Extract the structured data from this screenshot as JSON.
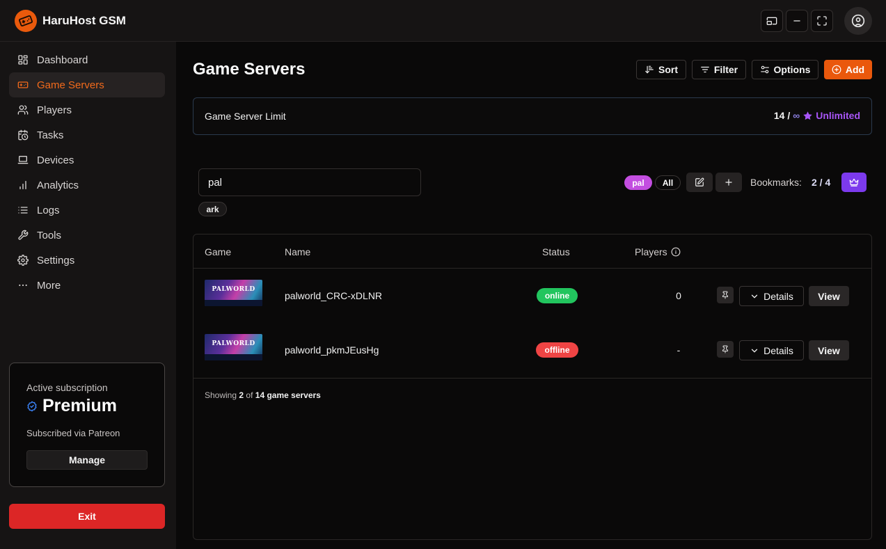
{
  "app": {
    "title": "HaruHost GSM"
  },
  "sidebar": {
    "items": [
      {
        "label": "Dashboard",
        "icon": "dashboard-icon"
      },
      {
        "label": "Game Servers",
        "icon": "gamepad-icon",
        "active": true
      },
      {
        "label": "Players",
        "icon": "users-icon"
      },
      {
        "label": "Tasks",
        "icon": "calendar-clock-icon"
      },
      {
        "label": "Devices",
        "icon": "laptop-icon"
      },
      {
        "label": "Analytics",
        "icon": "bar-chart-icon"
      },
      {
        "label": "Logs",
        "icon": "list-icon"
      },
      {
        "label": "Tools",
        "icon": "wrench-icon"
      },
      {
        "label": "Settings",
        "icon": "gear-icon"
      },
      {
        "label": "More",
        "icon": "ellipsis-icon"
      }
    ],
    "subscription": {
      "label": "Active subscription",
      "plan": "Premium",
      "via": "Subscribed via Patreon",
      "manage_label": "Manage"
    },
    "exit_label": "Exit"
  },
  "main": {
    "title": "Game Servers",
    "toolbar": {
      "sort_label": "Sort",
      "filter_label": "Filter",
      "options_label": "Options",
      "add_label": "Add"
    },
    "limit": {
      "label": "Game Server Limit",
      "used": "14 /",
      "max": "∞",
      "tier": "Unlimited"
    },
    "search": {
      "value": "pal",
      "placeholder": ""
    },
    "tags": {
      "ark": "ark",
      "pal": "pal",
      "all": "All"
    },
    "bookmarks": {
      "label": "Bookmarks:",
      "count": "2 / 4"
    },
    "table": {
      "headers": {
        "game": "Game",
        "name": "Name",
        "status": "Status",
        "players": "Players"
      },
      "rows": [
        {
          "game_logo": "PALWORLD",
          "name": "palworld_CRC-xDLNR",
          "status": "online",
          "players": "0",
          "details_label": "Details",
          "view_label": "View"
        },
        {
          "game_logo": "PALWORLD",
          "name": "palworld_pkmJEusHg",
          "status": "offline",
          "players": "-",
          "details_label": "Details",
          "view_label": "View"
        }
      ],
      "footer": {
        "prefix": "Showing",
        "shown": "2",
        "of": "of",
        "total": "14",
        "suffix": "game servers"
      }
    }
  },
  "colors": {
    "accent": "#ea580c",
    "online": "#22c55e",
    "offline": "#ef4444",
    "premium": "#a855f7",
    "exit": "#dc2626"
  }
}
